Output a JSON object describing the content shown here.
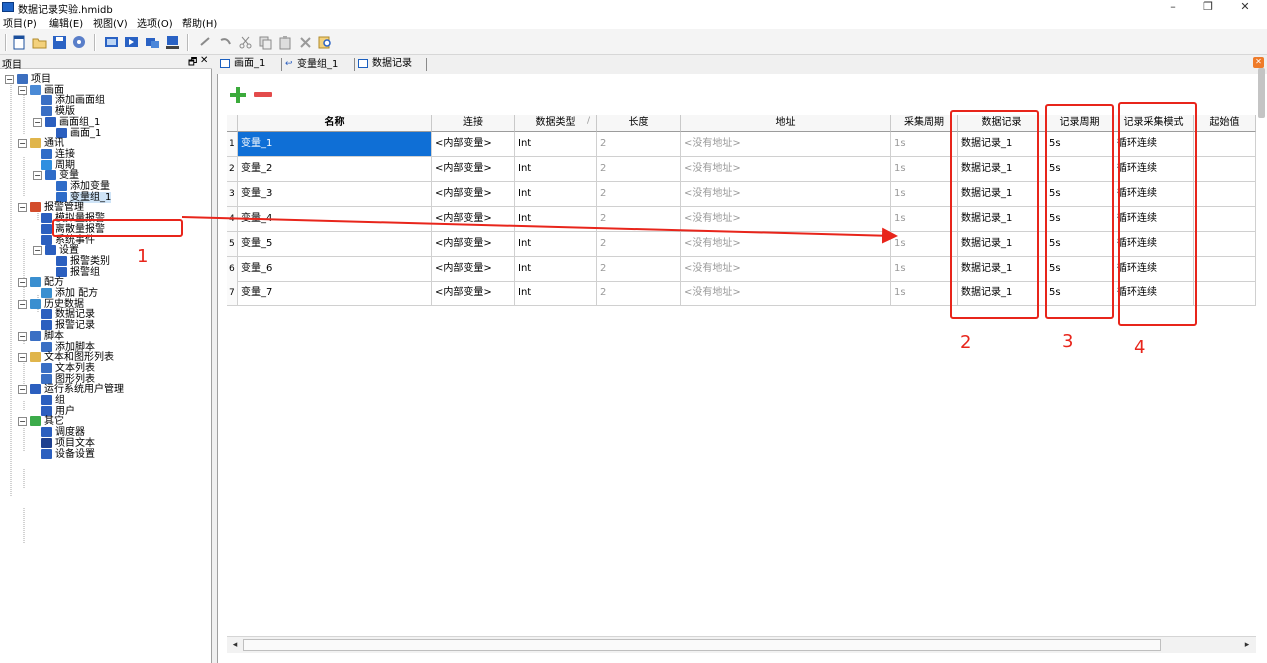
{
  "window": {
    "title": "数据记录实验.hmidb",
    "min": "–",
    "max": "❐",
    "close": "✕"
  },
  "menu": [
    "项目(P)",
    "编辑(E)",
    "视图(V)",
    "选项(O)",
    "帮助(H)"
  ],
  "left_panel": {
    "title": "项目",
    "pin": "🗗",
    "close": "✕",
    "tree": [
      {
        "label": "项目",
        "level": 0,
        "exp": "−",
        "icon": "project-icon",
        "color": "#3c6fbf"
      },
      {
        "label": "画面",
        "level": 1,
        "exp": "−",
        "icon": "screens-folder-icon",
        "color": "#4a8ad6"
      },
      {
        "label": "添加画面组",
        "level": 2,
        "exp": "",
        "icon": "add-screen-group-icon",
        "color": "#3a6fc4"
      },
      {
        "label": "模版",
        "level": 2,
        "exp": "",
        "icon": "template-icon",
        "color": "#3a6fc4"
      },
      {
        "label": "画面组_1",
        "level": 2,
        "exp": "−",
        "icon": "screen-group-icon",
        "color": "#2b5fbf"
      },
      {
        "label": "画面_1",
        "level": 3,
        "exp": "",
        "icon": "screen-icon",
        "color": "#2b5fbf"
      },
      {
        "label": "通讯",
        "level": 1,
        "exp": "−",
        "icon": "communication-icon",
        "color": "#e0b54b"
      },
      {
        "label": "连接",
        "level": 2,
        "exp": "",
        "icon": "connection-icon",
        "color": "#2f6cc8"
      },
      {
        "label": "周期",
        "level": 2,
        "exp": "",
        "icon": "cycle-icon",
        "color": "#2f8fe0"
      },
      {
        "label": "变量",
        "level": 2,
        "exp": "−",
        "icon": "variable-icon",
        "color": "#2f6cc8"
      },
      {
        "label": "添加变量",
        "level": 3,
        "exp": "",
        "icon": "add-variable-icon",
        "color": "#2f6cc8"
      },
      {
        "label": "变量组_1",
        "level": 3,
        "exp": "",
        "icon": "variable-group-icon",
        "color": "#2f6cc8",
        "selected": true
      },
      {
        "label": "报警管理",
        "level": 1,
        "exp": "−",
        "icon": "alarm-management-icon",
        "color": "#d34c2b"
      },
      {
        "label": "模拟量报警",
        "level": 2,
        "exp": "",
        "icon": "analog-alarm-icon",
        "color": "#2b5fbf"
      },
      {
        "label": "离散量报警",
        "level": 2,
        "exp": "",
        "icon": "discrete-alarm-icon",
        "color": "#2b5fbf"
      },
      {
        "label": "系统事件",
        "level": 2,
        "exp": "",
        "icon": "system-event-icon",
        "color": "#2b5fbf"
      },
      {
        "label": "设置",
        "level": 2,
        "exp": "−",
        "icon": "settings-icon",
        "color": "#2b5fbf"
      },
      {
        "label": "报警类别",
        "level": 3,
        "exp": "",
        "icon": "alarm-class-icon",
        "color": "#2b5fbf"
      },
      {
        "label": "报警组",
        "level": 3,
        "exp": "",
        "icon": "alarm-group-icon",
        "color": "#2b5fbf"
      },
      {
        "label": "配方",
        "level": 1,
        "exp": "−",
        "icon": "recipe-icon",
        "color": "#3a8fd0"
      },
      {
        "label": "添加 配方",
        "level": 2,
        "exp": "",
        "icon": "add-recipe-icon",
        "color": "#3a8fd0"
      },
      {
        "label": "历史数据",
        "level": 1,
        "exp": "−",
        "icon": "history-data-icon",
        "color": "#3a8fd0"
      },
      {
        "label": "数据记录",
        "level": 2,
        "exp": "",
        "icon": "data-log-icon",
        "color": "#2b5fbf"
      },
      {
        "label": "报警记录",
        "level": 2,
        "exp": "",
        "icon": "alarm-log-icon",
        "color": "#2b5fbf"
      },
      {
        "label": "脚本",
        "level": 1,
        "exp": "−",
        "icon": "script-icon",
        "color": "#3a6fc4"
      },
      {
        "label": "添加脚本",
        "level": 2,
        "exp": "",
        "icon": "add-script-icon",
        "color": "#3a6fc4"
      },
      {
        "label": "文本和图形列表",
        "level": 1,
        "exp": "−",
        "icon": "text-graphic-list-icon",
        "color": "#e0b54b"
      },
      {
        "label": "文本列表",
        "level": 2,
        "exp": "",
        "icon": "text-list-icon",
        "color": "#3a6fc4"
      },
      {
        "label": "图形列表",
        "level": 2,
        "exp": "",
        "icon": "graphic-list-icon",
        "color": "#3a6fc4"
      },
      {
        "label": "运行系统用户管理",
        "level": 1,
        "exp": "−",
        "icon": "user-management-icon",
        "color": "#2b5fbf"
      },
      {
        "label": "组",
        "level": 2,
        "exp": "",
        "icon": "group-icon",
        "color": "#2b5fbf"
      },
      {
        "label": "用户",
        "level": 2,
        "exp": "",
        "icon": "user-icon",
        "color": "#2b5fbf"
      },
      {
        "label": "其它",
        "level": 1,
        "exp": "−",
        "icon": "other-icon",
        "color": "#3cab4a"
      },
      {
        "label": "调度器",
        "level": 2,
        "exp": "",
        "icon": "scheduler-icon",
        "color": "#2b5fbf"
      },
      {
        "label": "项目文本",
        "level": 2,
        "exp": "",
        "icon": "project-text-icon",
        "color": "#1d3f8f"
      },
      {
        "label": "设备设置",
        "level": 2,
        "exp": "",
        "icon": "device-settings-icon",
        "color": "#2b5fbf"
      }
    ]
  },
  "editor_tabs": [
    {
      "label": "画面_1",
      "icon": "screen-tab-icon"
    },
    {
      "label": "变量组_1",
      "icon": "variable-group-tab-icon"
    },
    {
      "label": "数据记录",
      "icon": "data-log-tab-icon"
    }
  ],
  "editor_close": "✕",
  "grid": {
    "columns": [
      "名称",
      "连接",
      "数据类型",
      "长度",
      "地址",
      "采集周期",
      "数据记录",
      "记录周期",
      "记录采集模式",
      "起始值"
    ],
    "sort_marker": "/",
    "rows": [
      {
        "n": "1",
        "name": "变量_1",
        "conn": "<内部变量>",
        "type": "Int",
        "len": "2",
        "addr": "<没有地址>",
        "cycle": "1s",
        "log": "数据记录_1",
        "log_cycle": "5s",
        "mode": "循环连续"
      },
      {
        "n": "2",
        "name": "变量_2",
        "conn": "<内部变量>",
        "type": "Int",
        "len": "2",
        "addr": "<没有地址>",
        "cycle": "1s",
        "log": "数据记录_1",
        "log_cycle": "5s",
        "mode": "循环连续"
      },
      {
        "n": "3",
        "name": "变量_3",
        "conn": "<内部变量>",
        "type": "Int",
        "len": "2",
        "addr": "<没有地址>",
        "cycle": "1s",
        "log": "数据记录_1",
        "log_cycle": "5s",
        "mode": "循环连续"
      },
      {
        "n": "4",
        "name": "变量_4",
        "conn": "<内部变量>",
        "type": "Int",
        "len": "2",
        "addr": "<没有地址>",
        "cycle": "1s",
        "log": "数据记录_1",
        "log_cycle": "5s",
        "mode": "循环连续"
      },
      {
        "n": "5",
        "name": "变量_5",
        "conn": "<内部变量>",
        "type": "Int",
        "len": "2",
        "addr": "<没有地址>",
        "cycle": "1s",
        "log": "数据记录_1",
        "log_cycle": "5s",
        "mode": "循环连续"
      },
      {
        "n": "6",
        "name": "变量_6",
        "conn": "<内部变量>",
        "type": "Int",
        "len": "2",
        "addr": "<没有地址>",
        "cycle": "1s",
        "log": "数据记录_1",
        "log_cycle": "5s",
        "mode": "循环连续"
      },
      {
        "n": "7",
        "name": "变量_7",
        "conn": "<内部变量>",
        "type": "Int",
        "len": "2",
        "addr": "<没有地址>",
        "cycle": "1s",
        "log": "数据记录_1",
        "log_cycle": "5s",
        "mode": "循环连续"
      }
    ]
  },
  "scrollbar": {
    "left_arrow": "◂",
    "right_arrow": "▸"
  },
  "annotations": [
    "1",
    "2",
    "3",
    "4"
  ],
  "colors": {
    "annotation": "#e8251b",
    "selection": "#0f6fd6",
    "add": "#3cab3c",
    "remove": "#e34b4b"
  }
}
